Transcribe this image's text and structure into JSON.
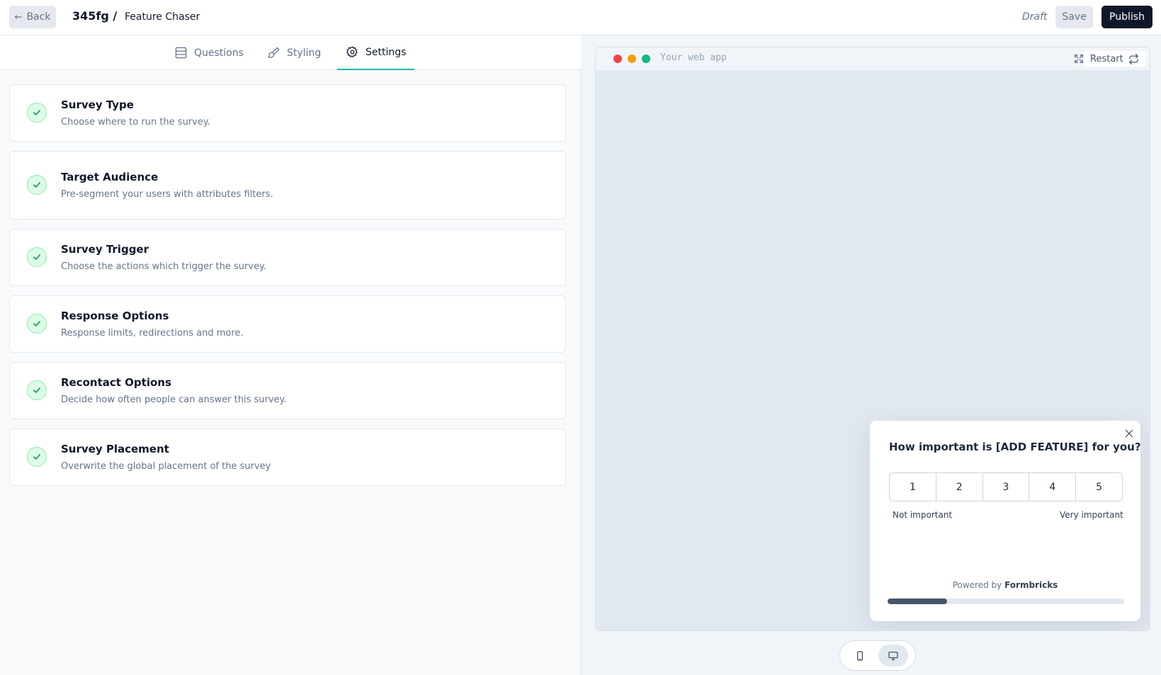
{
  "header": {
    "back_label": "Back",
    "env_id": "345fg /",
    "survey_name": "Feature Chaser",
    "status": "Draft",
    "save_label": "Save",
    "publish_label": "Publish"
  },
  "tabs": [
    {
      "label": "Questions",
      "icon": "list-icon",
      "active": false
    },
    {
      "label": "Styling",
      "icon": "paintbrush-icon",
      "active": false
    },
    {
      "label": "Settings",
      "icon": "gear-icon",
      "active": true
    }
  ],
  "settings_cards": [
    {
      "title": "Survey Type",
      "description": "Choose where to run the survey.",
      "complete": true
    },
    {
      "title": "Target Audience",
      "description": "Pre-segment your users with attributes filters.",
      "complete": true
    },
    {
      "title": "Survey Trigger",
      "description": "Choose the actions which trigger the survey.",
      "complete": true
    },
    {
      "title": "Response Options",
      "description": "Response limits, redirections and more.",
      "complete": true
    },
    {
      "title": "Recontact Options",
      "description": "Decide how often people can answer this survey.",
      "complete": true
    },
    {
      "title": "Survey Placement",
      "description": "Overwrite the global placement of the survey",
      "complete": true
    }
  ],
  "preview": {
    "url_placeholder": "Your web app",
    "restart_label": "Restart",
    "question": "How important is [ADD FEATURE] for you?",
    "rating_options": [
      "1",
      "2",
      "3",
      "4",
      "5"
    ],
    "lower_label": "Not important",
    "upper_label": "Very important",
    "powered_by_prefix": "Powered by",
    "powered_by_brand": "Formbricks",
    "progress": 0.25,
    "device_mode": "desktop"
  },
  "colors": {
    "accent": "#14b8a6",
    "primary": "#0f172a",
    "check_bg": "#dcfce7",
    "check_stroke": "#16a34a"
  }
}
